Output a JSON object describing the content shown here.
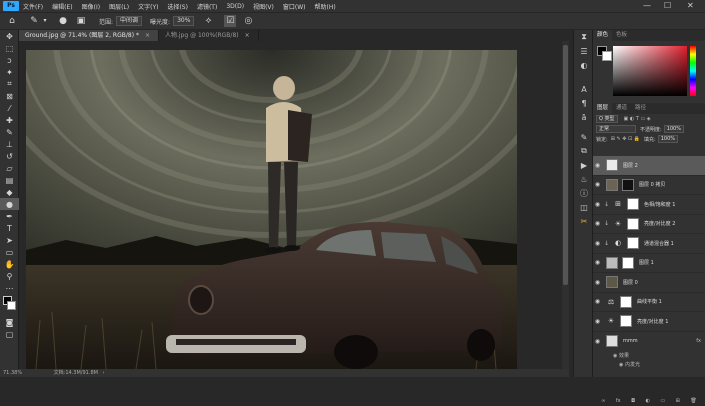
{
  "app": {
    "logo": "Ps",
    "menu": [
      "文件(F)",
      "编辑(E)",
      "图像(I)",
      "图层(L)",
      "文字(Y)",
      "选择(S)",
      "滤镜(T)",
      "3D(D)",
      "视图(V)",
      "窗口(W)",
      "帮助(H)"
    ],
    "window_controls": {
      "minimize": "—",
      "maximize": "☐",
      "close": "✕"
    }
  },
  "options_bar": {
    "range_label": "范围:",
    "range_value": "中间调",
    "exposure_label": "曝光度:",
    "exposure_value": "30%"
  },
  "tabs": [
    {
      "label": "Ground.jpg @ 71.4% (图层 2, RGB/8) *",
      "close": "×"
    },
    {
      "label": "人物.jpg @ 100%(RGB/8)",
      "close": "×"
    }
  ],
  "status": {
    "zoom": "71.38%",
    "doc": "文档:14.3M/91.8M"
  },
  "color_panel": {
    "tabs": [
      "颜色",
      "色板"
    ],
    "foreground": "#000000",
    "background": "#ffffff"
  },
  "layers_panel": {
    "tabs": [
      "图层",
      "通道",
      "路径"
    ],
    "filter_label": "Q 类型",
    "blend_mode": "正常",
    "opacity_label": "不透明度:",
    "opacity_value": "100%",
    "lock_label": "锁定:",
    "fill_label": "填充:",
    "fill_value": "100%",
    "layers": [
      {
        "name": "图层 2",
        "kind": "person",
        "selected": true
      },
      {
        "name": "图层 0 拷贝",
        "kind": "photo-mask"
      },
      {
        "name": "色相/饱和度 1",
        "kind": "adjust",
        "icon": "⊞"
      },
      {
        "name": "亮度/对比度 2",
        "kind": "adjust",
        "icon": "☀"
      },
      {
        "name": "通道混合器 1",
        "kind": "adjust",
        "icon": "◐"
      },
      {
        "name": "图层 1",
        "kind": "car-mask"
      },
      {
        "name": "图层 0",
        "kind": "photo"
      },
      {
        "name": "曲线平衡 1",
        "kind": "adjust",
        "icon": "⚖"
      },
      {
        "name": "亮度/对比度 1",
        "kind": "adjust",
        "icon": "☀"
      },
      {
        "name": "mmm",
        "kind": "group",
        "fx": "fx"
      }
    ],
    "effects_label": "效果",
    "inner_glow_label": "内发光"
  },
  "colors": {
    "accent": "#31a8ff",
    "panel": "#323232",
    "canvas_bg": "#282828"
  }
}
